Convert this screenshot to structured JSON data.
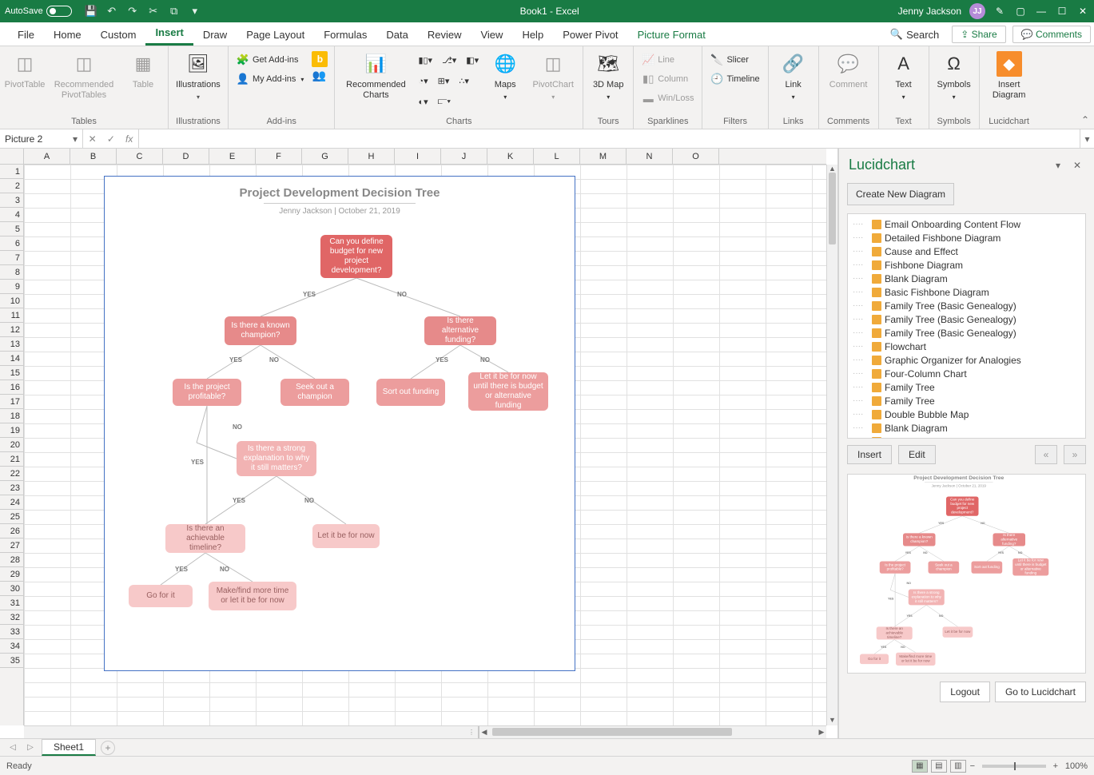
{
  "titlebar": {
    "autosave": "AutoSave",
    "title": "Book1 - Excel",
    "user": "Jenny Jackson",
    "initials": "JJ"
  },
  "menutabs": [
    "File",
    "Home",
    "Custom",
    "Insert",
    "Draw",
    "Page Layout",
    "Formulas",
    "Data",
    "Review",
    "View",
    "Help",
    "Power Pivot",
    "Picture Format"
  ],
  "menutabs_active": "Insert",
  "menutabs_green": "Picture Format",
  "search_label": "Search",
  "share_label": "Share",
  "comments_label": "Comments",
  "ribbon": {
    "tables": {
      "label": "Tables",
      "pivot": "PivotTable",
      "rec": "Recommended PivotTables",
      "table": "Table"
    },
    "illus": {
      "label": "Illustrations",
      "btn": "Illustrations"
    },
    "addins": {
      "label": "Add-ins",
      "get": "Get Add-ins",
      "my": "My Add-ins"
    },
    "charts": {
      "label": "Charts",
      "rec": "Recommended Charts",
      "maps": "Maps",
      "pivot": "PivotChart"
    },
    "tours": {
      "label": "Tours",
      "map": "3D Map"
    },
    "spark": {
      "label": "Sparklines",
      "line": "Line",
      "col": "Column",
      "wl": "Win/Loss"
    },
    "filters": {
      "label": "Filters",
      "slicer": "Slicer",
      "timeline": "Timeline"
    },
    "links": {
      "label": "Links",
      "link": "Link"
    },
    "comments": {
      "label": "Comments",
      "comment": "Comment"
    },
    "text": {
      "label": "Text",
      "text": "Text"
    },
    "symbols": {
      "label": "Symbols",
      "sym": "Symbols"
    },
    "lucid": {
      "label": "Lucidchart",
      "btn": "Insert Diagram"
    }
  },
  "namebox": "Picture 2",
  "columns": [
    "A",
    "B",
    "C",
    "D",
    "E",
    "F",
    "G",
    "H",
    "I",
    "J",
    "K",
    "L",
    "M",
    "N",
    "O"
  ],
  "rowcount": 35,
  "flowchart": {
    "title": "Project Development Decision Tree",
    "sub": "Jenny Jackson  |  October 21, 2019",
    "nodes": {
      "root": "Can you define budget for new project development?",
      "champ": "Is there a known champion?",
      "alt": "Is there alternative funding?",
      "profit": "Is the project profitable?",
      "seek": "Seek out a champion",
      "sort": "Sort out funding",
      "letbe_long": "Let it be for now until there is budget or alternative funding",
      "strong": "Is there a strong explanation to why it still matters?",
      "timeline": "Is there an achievable timeline?",
      "letbe": "Let it be for now",
      "go": "Go for it",
      "make": "Make/find more time or let it be for now"
    },
    "labels": {
      "yes": "YES",
      "no": "NO"
    }
  },
  "panel": {
    "title": "Lucidchart",
    "create": "Create New Diagram",
    "items": [
      "Email Onboarding Content Flow",
      "Detailed Fishbone Diagram",
      "Cause and Effect",
      "Fishbone Diagram",
      "Blank Diagram",
      "Basic Fishbone Diagram",
      "Family Tree (Basic Genealogy)",
      "Family Tree (Basic Genealogy)",
      "Family Tree (Basic Genealogy)",
      "Flowchart",
      "Graphic Organizer for Analogies",
      "Four-Column Chart",
      "Family Tree",
      "Family Tree",
      "Double Bubble Map",
      "Blank Diagram",
      "Blank Diagram"
    ],
    "insert": "Insert",
    "edit": "Edit",
    "prev": "«",
    "next": "»",
    "logout": "Logout",
    "goto": "Go to Lucidchart"
  },
  "sheet": {
    "name": "Sheet1"
  },
  "status": {
    "ready": "Ready",
    "zoom": "100%"
  }
}
